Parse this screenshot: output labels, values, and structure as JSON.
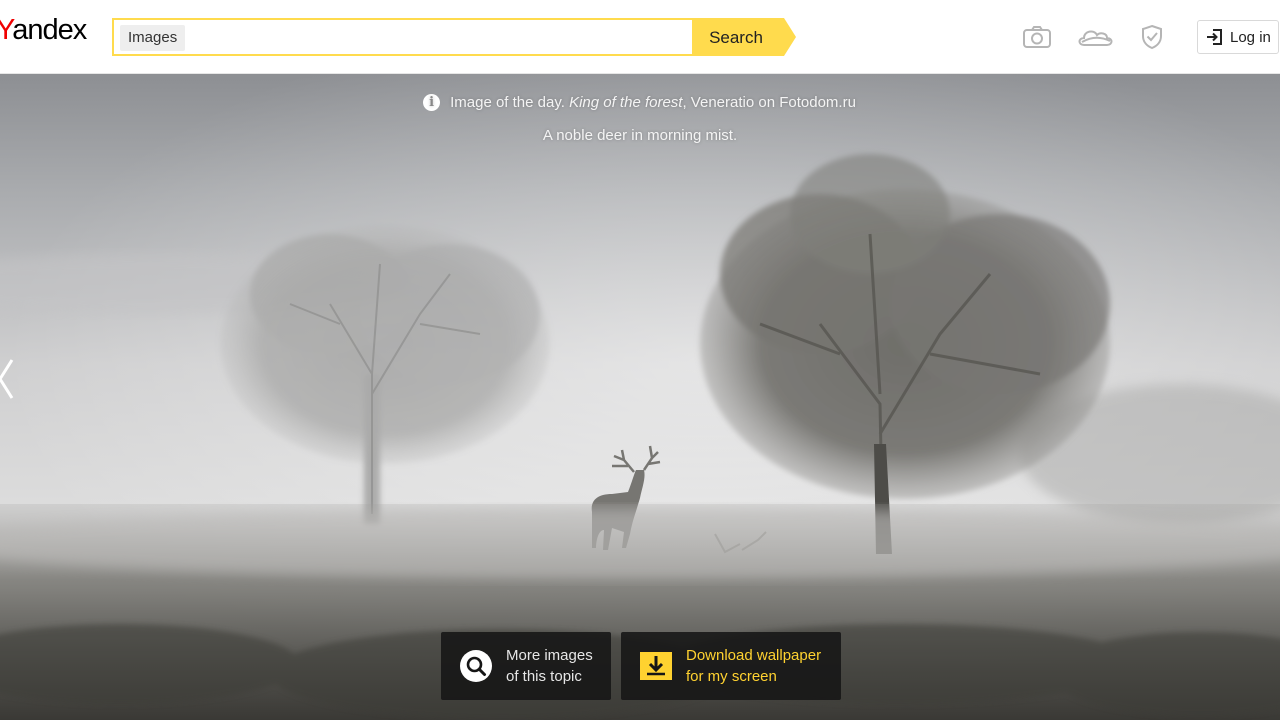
{
  "header": {
    "logo_first_letter": "Y",
    "logo_rest": "andex",
    "search": {
      "tag_label": "Images",
      "value": "",
      "placeholder": "",
      "button_label": "Search"
    },
    "icons": [
      "camera-icon",
      "cloud-icon",
      "shield-icon"
    ],
    "login_label": "Log in"
  },
  "image_of_the_day": {
    "prefix": "Image of the day.",
    "title": "King of the forest",
    "credit": ", Veneratio on Fotodom.ru",
    "description": "A noble deer in morning mist."
  },
  "actions": {
    "more_images_line1": "More images",
    "more_images_line2": "of this topic",
    "download_line1": "Download wallpaper",
    "download_line2": "for my screen"
  },
  "colors": {
    "brand_yellow": "#ffdb4d",
    "logo_red": "#f00000",
    "download_text": "#ffd230"
  }
}
